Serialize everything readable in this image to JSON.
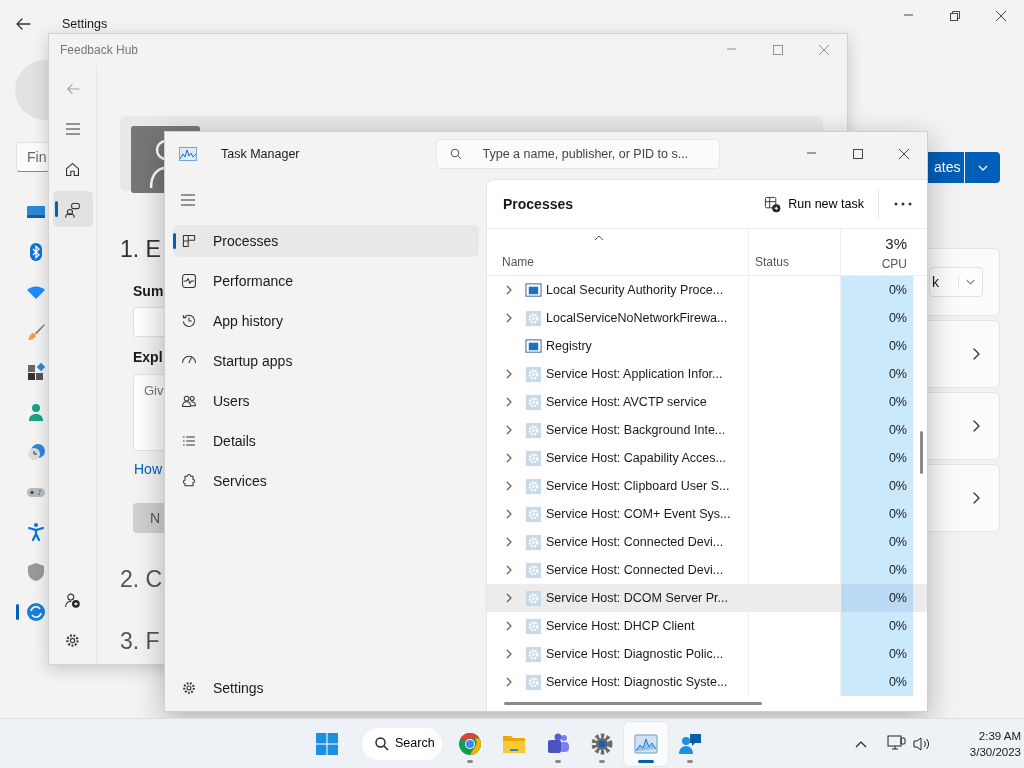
{
  "settings_window": {
    "title": "Settings",
    "search": {
      "placeholder": "Fin"
    },
    "sidebar": [
      {
        "kind": "display",
        "selected": false
      },
      {
        "kind": "bluetooth",
        "selected": false
      },
      {
        "kind": "wifi",
        "selected": false
      },
      {
        "kind": "brush",
        "selected": false
      },
      {
        "kind": "apps",
        "selected": false
      },
      {
        "kind": "person",
        "selected": false
      },
      {
        "kind": "clock",
        "selected": false
      },
      {
        "kind": "gamepad",
        "selected": false
      },
      {
        "kind": "accessibility",
        "selected": false
      },
      {
        "kind": "shield",
        "selected": false
      },
      {
        "kind": "update",
        "selected": true
      }
    ],
    "update_button": "ates",
    "cards": [
      {
        "kind": "dropdown",
        "value": "k"
      },
      {
        "kind": "link"
      },
      {
        "kind": "link"
      },
      {
        "kind": "link"
      }
    ]
  },
  "feedback_hub": {
    "title": "Feedback Hub",
    "nav": [
      {
        "kind": "home",
        "selected": false
      },
      {
        "kind": "feedback",
        "selected": true
      }
    ],
    "bottom_nav": [
      {
        "kind": "add-user"
      },
      {
        "kind": "settings"
      }
    ],
    "step_1": "1. E",
    "summary_label": "Sum",
    "explain_label": "Expl",
    "explain_placeholder": "Giv",
    "link": "How",
    "next_button": {
      "label": "N",
      "disabled": true
    },
    "step_2": "2. C",
    "step_3": "3. F"
  },
  "task_manager": {
    "title": "Task Manager",
    "search": {
      "placeholder": "Type a name, publisher, or PID to s..."
    },
    "nav": [
      {
        "kind": "processes",
        "label": "Processes",
        "selected": true
      },
      {
        "kind": "performance",
        "label": "Performance",
        "selected": false
      },
      {
        "kind": "history",
        "label": "App history",
        "selected": false
      },
      {
        "kind": "startup",
        "label": "Startup apps",
        "selected": false
      },
      {
        "kind": "users",
        "label": "Users",
        "selected": false
      },
      {
        "kind": "details",
        "label": "Details",
        "selected": false
      },
      {
        "kind": "services",
        "label": "Services",
        "selected": false
      }
    ],
    "settings_label": "Settings",
    "panel_title": "Processes",
    "run_new_task": "Run new task",
    "columns": {
      "name": "Name",
      "status": "Status",
      "cpu_total": "3%",
      "cpu": "CPU"
    },
    "rows": [
      {
        "name": "Local Security Authority Proce...",
        "kind": "window",
        "expandable": true,
        "highlighted": false,
        "cpu": "0%"
      },
      {
        "name": "LocalServiceNoNetworkFirewa...",
        "kind": "gear",
        "expandable": true,
        "highlighted": false,
        "cpu": "0%"
      },
      {
        "name": "Registry",
        "kind": "window",
        "expandable": false,
        "highlighted": false,
        "cpu": "0%"
      },
      {
        "name": "Service Host: Application Infor...",
        "kind": "gear",
        "expandable": true,
        "highlighted": false,
        "cpu": "0%"
      },
      {
        "name": "Service Host: AVCTP service",
        "kind": "gear",
        "expandable": true,
        "highlighted": false,
        "cpu": "0%"
      },
      {
        "name": "Service Host: Background Inte...",
        "kind": "gear",
        "expandable": true,
        "highlighted": false,
        "cpu": "0%"
      },
      {
        "name": "Service Host: Capability Acces...",
        "kind": "gear",
        "expandable": true,
        "highlighted": false,
        "cpu": "0%"
      },
      {
        "name": "Service Host: Clipboard User S...",
        "kind": "gear",
        "expandable": true,
        "highlighted": false,
        "cpu": "0%"
      },
      {
        "name": "Service Host: COM+ Event Sys...",
        "kind": "gear",
        "expandable": true,
        "highlighted": false,
        "cpu": "0%"
      },
      {
        "name": "Service Host: Connected Devi...",
        "kind": "gear",
        "expandable": true,
        "highlighted": false,
        "cpu": "0%"
      },
      {
        "name": "Service Host: Connected Devi...",
        "kind": "gear",
        "expandable": true,
        "highlighted": false,
        "cpu": "0%"
      },
      {
        "name": "Service Host: DCOM Server Pr...",
        "kind": "gear",
        "expandable": true,
        "highlighted": true,
        "cpu": "0%"
      },
      {
        "name": "Service Host: DHCP Client",
        "kind": "gear",
        "expandable": true,
        "highlighted": false,
        "cpu": "0%"
      },
      {
        "name": "Service Host: Diagnostic Polic...",
        "kind": "gear",
        "expandable": true,
        "highlighted": false,
        "cpu": "0%"
      },
      {
        "name": "Service Host: Diagnostic Syste...",
        "kind": "gear",
        "expandable": true,
        "highlighted": false,
        "cpu": "0%"
      }
    ]
  },
  "taskbar": {
    "search_label": "Search",
    "apps": [
      {
        "kind": "chrome",
        "running": true,
        "selected": false
      },
      {
        "kind": "folder",
        "running": false,
        "selected": false
      },
      {
        "kind": "teams",
        "running": true,
        "selected": false
      },
      {
        "kind": "settings",
        "running": true,
        "selected": false
      },
      {
        "kind": "task-manager",
        "running": true,
        "selected": true
      },
      {
        "kind": "feedback",
        "running": true,
        "selected": false
      }
    ],
    "time": "2:39 AM",
    "date": "3/30/2023"
  }
}
